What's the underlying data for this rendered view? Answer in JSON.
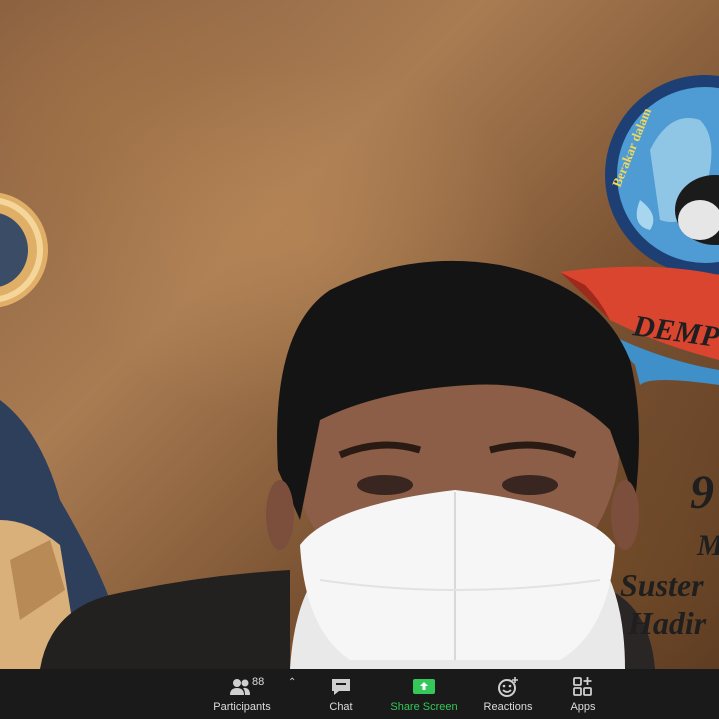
{
  "video": {
    "logo_arc_text": "Berakar dalam",
    "logo_banner_text": "DEMPO",
    "caption_lines": [
      "9",
      "M",
      "Suster",
      "Hadir"
    ]
  },
  "toolbar": {
    "participants_count": "88",
    "participants_label": "Participants",
    "chat_label": "Chat",
    "share_label": "Share Screen",
    "reactions_label": "Reactions",
    "apps_label": "Apps"
  },
  "icons": {
    "participants": "participants-icon",
    "chevron": "chevron-up-icon",
    "chat": "chat-bubble-icon",
    "share": "share-screen-icon",
    "reactions": "reactions-icon",
    "apps": "apps-icon"
  },
  "colors": {
    "toolbar_bg": "#1a1a1a",
    "share_green": "#35c759",
    "banner_red": "#d9452f",
    "logo_blue": "#3f8fc9"
  }
}
